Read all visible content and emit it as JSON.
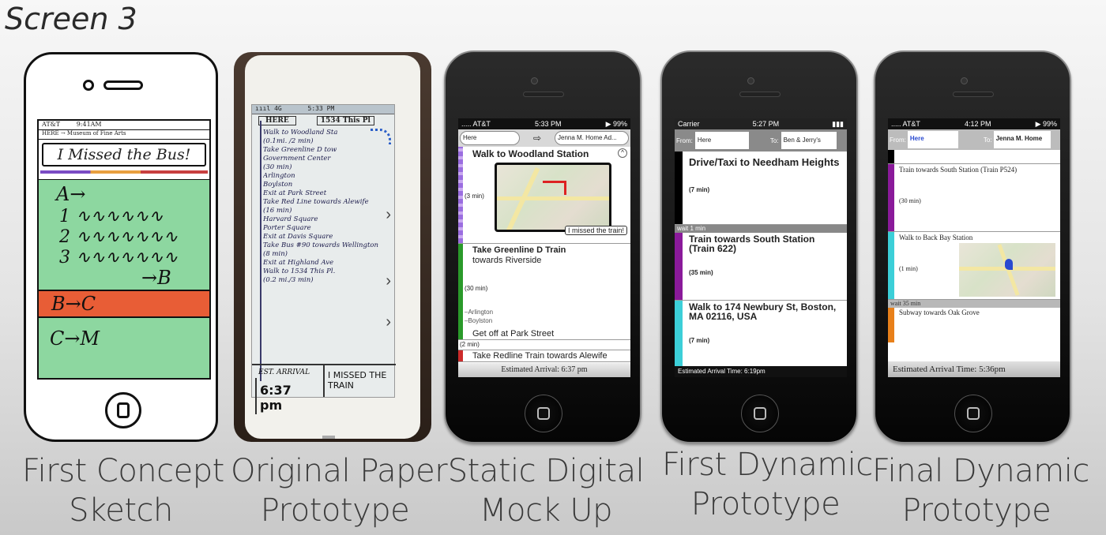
{
  "title": "Screen 3",
  "captions": [
    {
      "line1": "First Concept",
      "line2": "Sketch"
    },
    {
      "line1": "Original Paper",
      "line2": "Prototype"
    },
    {
      "line1": "Static Digital",
      "line2": "Mock Up"
    },
    {
      "line1": "First Dynamic",
      "line2": "Prototype"
    },
    {
      "line1": "Final Dynamic",
      "line2": "Prototype"
    }
  ],
  "sketch": {
    "carrier": "AT&T",
    "time": "9:41AM",
    "route": "HERE → Museum of Fine Arts",
    "missed_label": "I Missed the Bus!",
    "lines": [
      "A→",
      "1",
      "2",
      "3",
      "→B",
      "B→C",
      "C→M"
    ]
  },
  "paper": {
    "signal": "ıııl 4G",
    "time": "5:33 PM",
    "from": "HERE",
    "to": "1534 This Pl",
    "steps": [
      "Walk to Woodland Sta",
      "(0.1mi. /2 min)",
      "Take Greenline D tow",
      "Government Center",
      "",
      "",
      "(30 min)",
      "Arlington",
      "Boylston",
      "Exit at Park Street",
      "Take Red Line towards Alewife",
      "(16 min)",
      "Harvard Square",
      "Porter Square",
      "Exit at Davis Square",
      "Take Bus #90 towards Wellington",
      "(8 min)",
      "",
      "Exit at Highland Ave",
      "Walk to 1534 This Pl.",
      "(0.2 mi./3 min)"
    ],
    "arrival_label": "EST. ARRIVAL",
    "arrival_time": "6:37 pm",
    "missed_label": "I MISSED THE TRAIN"
  },
  "static": {
    "carrier": "..... AT&T",
    "time": "5:33 PM",
    "battery": "▶ 99%",
    "from": "Here",
    "to": "Jenna M. Home Ad...",
    "step1_title": "Walk to Woodland Station",
    "step1_time": "(3 min)",
    "missed_button": "I missed the train!",
    "step2_title": "Take Greenline D Train",
    "step2_sub": "towards Riverside",
    "step2_time": "(30 min)",
    "stop1": "Arlington",
    "stop2": "Boylston",
    "step2_exit": "Get off at Park Street",
    "step3_time": "(2 min)",
    "step3_title": "Take Redline Train towards Alewife",
    "footer": "Estimated Arrival: 6:37 pm",
    "colors": {
      "walk": "#9b6de0",
      "green": "#2a9a2a",
      "red": "#cc2a2a"
    }
  },
  "dynamic1": {
    "carrier": "Carrier",
    "time": "5:27 PM",
    "from_label": "From:",
    "from": "Here",
    "to_label": "To:",
    "to": "Ben & Jerry's",
    "step1_title": "Drive/Taxi to Needham Heights",
    "step1_time": "(7 min)",
    "wait": "wait 1 min",
    "step2_title": "Train towards South Station (Train 622)",
    "step2_time": "(35 min)",
    "step3_title": "Walk to 174 Newbury St, Boston, MA 02116, USA",
    "step3_time": "(7 min)",
    "footer": "Estimated Arrival Time: 6:19pm",
    "colors": {
      "drive": "#000000",
      "train": "#8a1a9a",
      "walk": "#3ccfd8"
    }
  },
  "final": {
    "carrier": "..... AT&T",
    "time": "4:12 PM",
    "battery": "▶ 99%",
    "from_label": "From:",
    "from": "Here",
    "to_label": "To:",
    "to": "Jenna M. Home",
    "step1_title": "Train towards South Station (Train P524)",
    "step1_time": "(30 min)",
    "step2_title": "Walk to Back Bay Station",
    "step2_time": "(1 min)",
    "wait": "wait 35 min",
    "step3_title": "Subway towards Oak Grove",
    "footer": "Estimated Arrival Time: 5:36pm",
    "colors": {
      "drive": "#000000",
      "train": "#8a1a9a",
      "walk": "#3ccfd8",
      "subway": "#e8801a"
    }
  }
}
